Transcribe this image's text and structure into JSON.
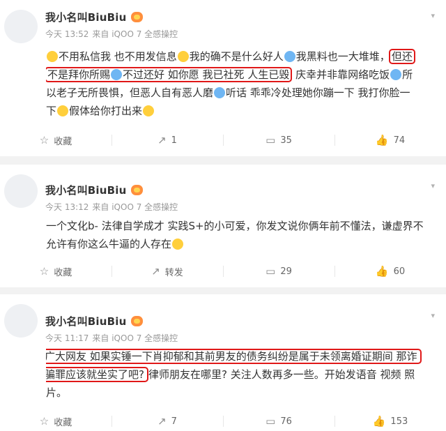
{
  "icons": {
    "chevron": "▾",
    "favorite": "☆",
    "repost": "↗",
    "comment": "▭",
    "like": "👍"
  },
  "posts": [
    {
      "author": "我小名叫BiuBiu",
      "time": "今天 13:52",
      "source": "来自 iQOO 7 全感操控",
      "lines": [
        [
          "不用私信我 也不用发信息",
          "我的确不是什么好人",
          "我黑料也一大堆堆，",
          "但还"
        ],
        [
          "不是拜你所赐",
          "不过还好 如你愿 我已社死 人生已毁",
          "庆幸并非靠网络吃饭",
          "所"
        ],
        [
          "以老子无所畏惧，但恶人自有恶人磨",
          "听话 乖乖冷处理她你蹦一下 我打你脸一"
        ],
        [
          "下",
          "假体给你打出来"
        ]
      ],
      "actions": {
        "favorite": "收藏",
        "repost": "1",
        "comment": "35",
        "like": "74"
      }
    },
    {
      "author": "我小名叫BiuBiu",
      "time": "今天 13:12",
      "source": "来自 iQOO 7 全感操控",
      "lines": [
        [
          "一个文化b- 法律自学成才 实践S+的小可爱，你发文说你俩年前不懂法，谦虚界不"
        ],
        [
          "允许有你这么牛逼的人存在"
        ]
      ],
      "actions": {
        "favorite": "收藏",
        "repost": "转发",
        "comment": "29",
        "like": "60"
      }
    },
    {
      "author": "我小名叫BiuBiu",
      "time": "今天 11:17",
      "source": "来自 iQOO 7 全感操控",
      "lines": [
        [
          "广大网友 如果实锤一下肖抑郁和其前男友的债务纠纷是属于未领离婚证期间 那诈"
        ],
        [
          "骗罪应该就坐实了吧?",
          "律师朋友在哪里? 关注人数再多一些。开始发语音 视频 照"
        ],
        [
          "片。"
        ]
      ],
      "actions": {
        "favorite": "收藏",
        "repost": "7",
        "comment": "76",
        "like": "153"
      }
    }
  ]
}
